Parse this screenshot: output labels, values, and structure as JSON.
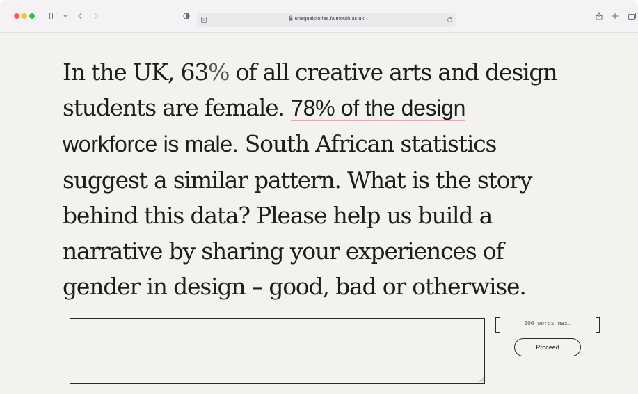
{
  "browser": {
    "url": "unequalstories.falmouth.ac.uk"
  },
  "page": {
    "headline": {
      "part1": "In the UK, 63",
      "percent": "%",
      "part2": " of all creative arts and design students are female. ",
      "highlight": "78% of the design workforce is male.",
      "part3": " South African statistics suggest a similar pattern. What is the story behind this data? Please help us build a narrative by sharing your experiences of gender in design – good, bad or otherwise."
    },
    "response": {
      "value": "",
      "word_limit": "200 words max.",
      "proceed_label": "Proceed"
    }
  },
  "colors": {
    "background": "#f3f2ef",
    "text": "#1d1d1d",
    "highlight_underline": "#e7a6ba"
  }
}
